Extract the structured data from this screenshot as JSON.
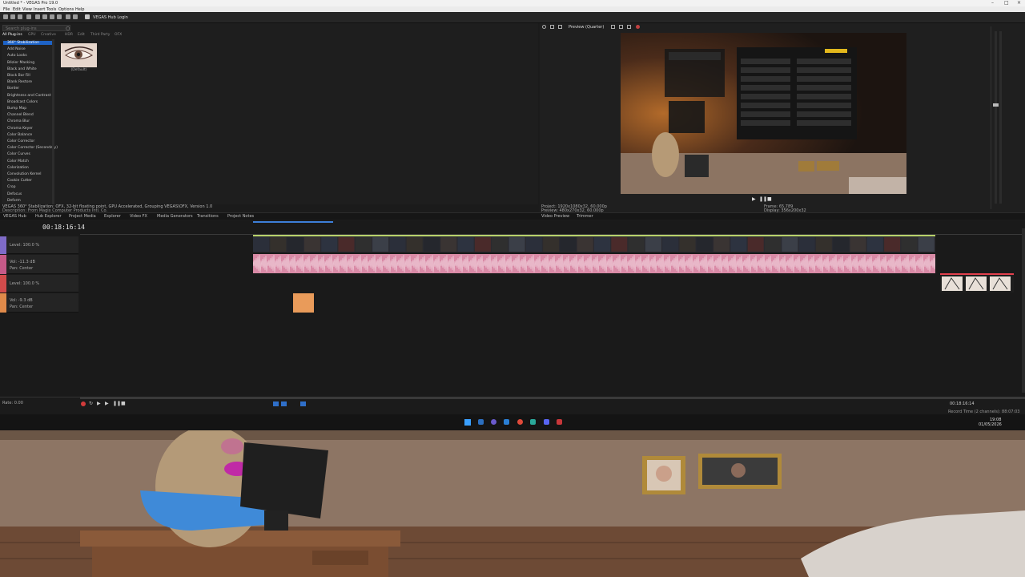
{
  "app": {
    "title": "Untitled * - VEGAS Pro 19.0",
    "toolbar_label": "VEGAS Hub Login"
  },
  "menu": [
    "File",
    "Edit",
    "View",
    "Insert",
    "Tools",
    "Options",
    "Help"
  ],
  "fx_panel": {
    "search_placeholder": "Search plug-ins",
    "tabs": [
      "All Plug-ins",
      "GPU",
      "Creative",
      "HDR",
      "Edit",
      "Third Party",
      "OFX"
    ],
    "items": [
      "360° Stabilization",
      "Add Noise",
      "Auto Looks",
      "Bézier Masking",
      "Black and White",
      "Block Bar Fill",
      "Blank Restore",
      "Border",
      "Brightness and Contrast",
      "Broadcast Colors",
      "Bump Map",
      "Channel Blend",
      "Chroma Blur",
      "Chroma Keyer",
      "Color Balance",
      "Color Corrector",
      "Color Corrector (Secondary)",
      "Color Curves",
      "Color Match",
      "Colorization",
      "Convolution Kernel",
      "Cookie Cutter",
      "Crop",
      "Defocus",
      "Deform"
    ],
    "selected_index": 0,
    "preset_label": "(Default)",
    "status_line1": "VEGAS 360° Stabilization: OFX, 32-bit floating point, GPU Accelerated, Grouping VEGAS\\OFX, Version 1.0",
    "status_line2": "Description: From Magix Computer Products Intl. Co."
  },
  "preview": {
    "mode": "Preview (Quarter)",
    "project_info": "Project: 1920x1080x32, 60.000p",
    "preview_info": "Preview: 480x270x32, 60.000p",
    "frame_info": "Frame: 65,789",
    "display_info": "Display: 356x200x32"
  },
  "dock_tabs": [
    "VEGAS Hub",
    "Hub Explorer",
    "Project Media",
    "Explorer",
    "Video FX",
    "Media Generators",
    "Transitions",
    "Project Notes",
    "Video Preview",
    "Trimmer"
  ],
  "timeline": {
    "timecode": "00:18:16:14",
    "tracks": [
      {
        "kind": "video",
        "level": "Level: 100.0 %"
      },
      {
        "kind": "audio",
        "vol": "Vol: -11.3 dB",
        "pan": "Pan: Center"
      },
      {
        "kind": "video",
        "level": "Level: 100.0 %"
      },
      {
        "kind": "audio",
        "vol": "Vol: -9.3 dB",
        "pan": "Pan: Center"
      }
    ],
    "rate": "Rate: 0.00",
    "end_timecode": "00:18:16:14",
    "record_time": "Record Time (2 channels): 88:07:03"
  },
  "taskbar": {
    "time": "19:08",
    "date": "01/05/2026"
  },
  "colors": {
    "accent": "#1e63c6",
    "video_clip_border": "#b9d36b",
    "audio_clip": "#d98aa6",
    "event_orange": "#e99b5a",
    "event_red": "#e2404d"
  }
}
